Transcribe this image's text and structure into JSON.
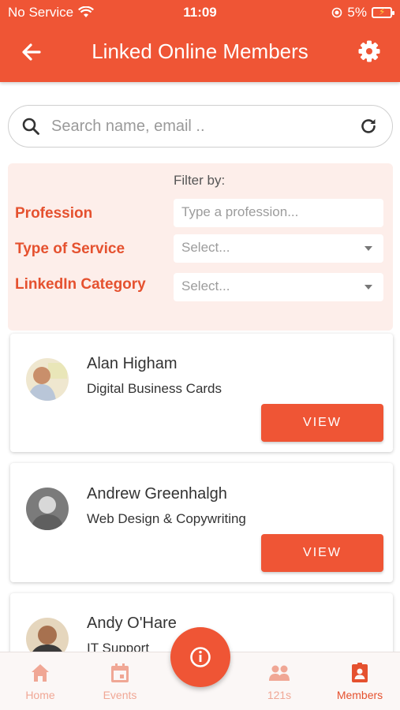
{
  "status": {
    "carrier": "No Service",
    "time": "11:09",
    "battery": "5%"
  },
  "header": {
    "title": "Linked Online Members"
  },
  "search": {
    "placeholder": "Search name, email .."
  },
  "filter": {
    "heading": "Filter by:",
    "profession_label": "Profession",
    "profession_placeholder": "Type a profession...",
    "service_label": "Type of Service",
    "service_value": "Select...",
    "linkedin_label": "LinkedIn Category",
    "linkedin_value": "Select..."
  },
  "members": [
    {
      "name": "Alan Higham",
      "role": "Digital Business Cards",
      "button": "VIEW"
    },
    {
      "name": "Andrew Greenhalgh",
      "role": "Web Design & Copywriting",
      "button": "VIEW"
    },
    {
      "name": "Andy O'Hare",
      "role": "IT Support"
    }
  ],
  "nav": {
    "home": "Home",
    "events": "Events",
    "ones": "121s",
    "members": "Members"
  },
  "colors": {
    "accent": "#ef5535",
    "filter_bg": "#fdeeea",
    "nav_inactive": "#f0a795"
  }
}
